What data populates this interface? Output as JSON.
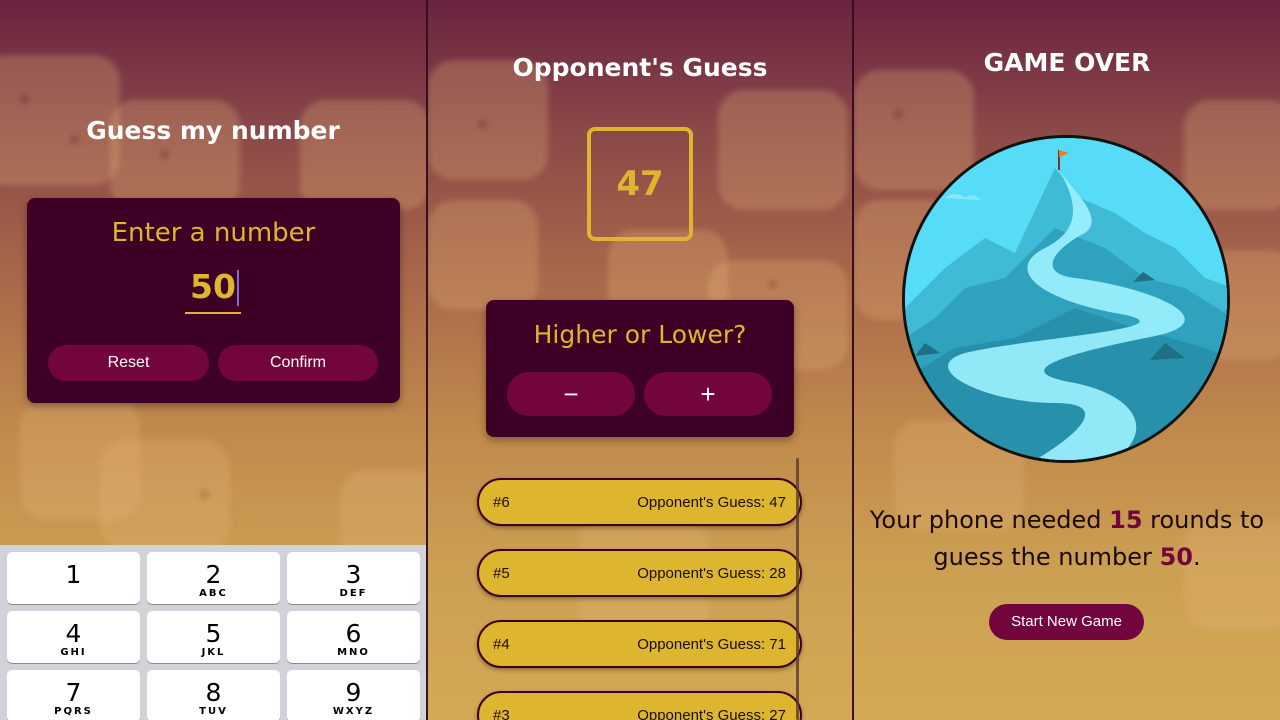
{
  "screens": {
    "start": {
      "title": "Guess my number",
      "prompt": "Enter a number",
      "input_value": "50",
      "reset_label": "Reset",
      "confirm_label": "Confirm",
      "keypad": [
        {
          "num": "1",
          "letters": ""
        },
        {
          "num": "2",
          "letters": "ABC"
        },
        {
          "num": "3",
          "letters": "DEF"
        },
        {
          "num": "4",
          "letters": "GHI"
        },
        {
          "num": "5",
          "letters": "JKL"
        },
        {
          "num": "6",
          "letters": "MNO"
        },
        {
          "num": "7",
          "letters": "PQRS"
        },
        {
          "num": "8",
          "letters": "TUV"
        },
        {
          "num": "9",
          "letters": "WXYZ"
        }
      ]
    },
    "game": {
      "title": "Opponent's Guess",
      "current_guess": "47",
      "prompt": "Higher or Lower?",
      "minus_label": "−",
      "plus_label": "+",
      "log": [
        {
          "round": "#6",
          "text": "Opponent's Guess: 47"
        },
        {
          "round": "#5",
          "text": "Opponent's Guess: 28"
        },
        {
          "round": "#4",
          "text": "Opponent's Guess: 71"
        },
        {
          "round": "#3",
          "text": "Opponent's Guess: 27"
        }
      ]
    },
    "game_over": {
      "title": "GAME OVER",
      "summary_before": "Your phone needed ",
      "rounds": "15",
      "summary_middle": " rounds to guess the number ",
      "number": "50",
      "summary_after": ".",
      "start_new_label": "Start New Game"
    }
  },
  "colors": {
    "accent_gold": "#ddb52f",
    "primary_dark": "#3c0124",
    "primary_button": "#72063c"
  }
}
